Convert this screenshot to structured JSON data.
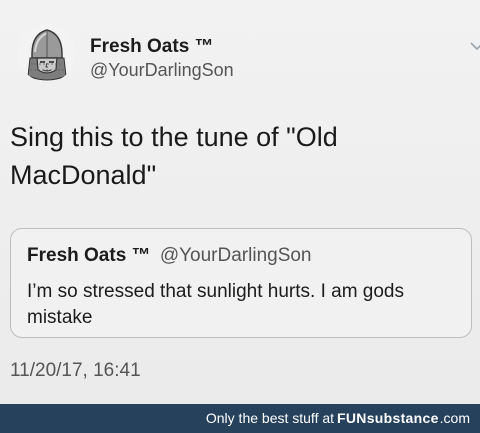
{
  "tweet": {
    "author": {
      "display_name": "Fresh Oats ™",
      "handle": "@YourDarlingSon",
      "avatar_icon": "knight-helmet-avatar"
    },
    "text": "Sing this to the tune of \"Old\nMacDonald\"",
    "timestamp": "11/20/17, 16:41",
    "more_icon": "chevron-down-icon"
  },
  "quoted_tweet": {
    "display_name": "Fresh Oats ™",
    "handle": "@YourDarlingSon",
    "text": "I’m so stressed that sunlight hurts. I am gods mistake"
  },
  "watermark": {
    "prefix": "Only the best stuff at",
    "brand": "FUNsubstance",
    "domain": ".com",
    "bar_color": "#26415c",
    "text_color": "#ffffff"
  }
}
